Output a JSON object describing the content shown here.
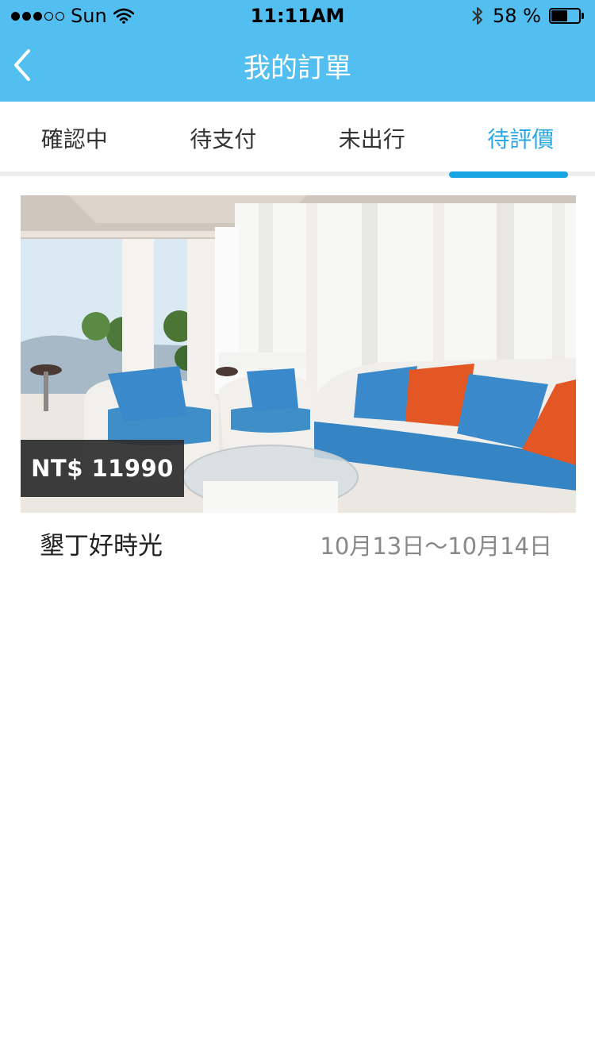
{
  "status_bar": {
    "carrier": "Sun",
    "time": "11:11AM",
    "battery_text": "58 %",
    "battery_level_percent": 58
  },
  "nav": {
    "title": "我的訂單",
    "back_icon": "chevron-left-icon"
  },
  "tabs": [
    {
      "label": "確認中",
      "active": false
    },
    {
      "label": "待支付",
      "active": false
    },
    {
      "label": "未出行",
      "active": false
    },
    {
      "label": "待評價",
      "active": true
    }
  ],
  "orders": [
    {
      "price": "NT$ 11990",
      "name": "墾丁好時光",
      "dates": "10月13日～10月14日"
    }
  ],
  "colors": {
    "header": "#52bff0",
    "tab_active": "#2aa8e4",
    "tab_indicator": "#1aa3e2"
  }
}
